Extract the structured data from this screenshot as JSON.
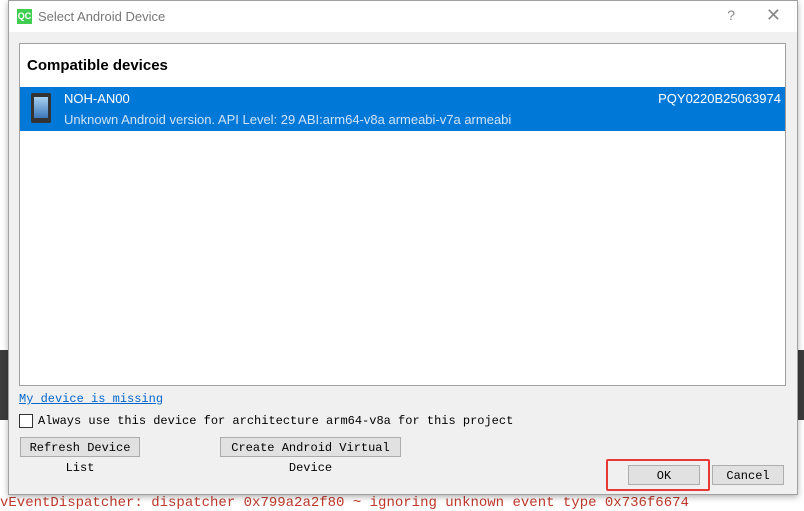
{
  "window": {
    "title": "Select Android Device",
    "help": "?",
    "close": "✕",
    "logo": "QC"
  },
  "list": {
    "header": "Compatible devices",
    "devices": [
      {
        "name": "NOH-AN00",
        "serial": "PQY0220B25063974",
        "description": "Unknown Android version. API Level: 29  ABI:arm64-v8a armeabi-v7a armeabi",
        "selected": true
      }
    ]
  },
  "missing_link": "My device is missing",
  "always_use": {
    "label": "Always use this device for architecture arm64-v8a for this project",
    "checked": false
  },
  "buttons": {
    "refresh": "Refresh Device List",
    "create_avd": "Create Android Virtual Device",
    "ok": "OK",
    "cancel": "Cancel"
  },
  "background_log": "vEventDispatcher: dispatcher 0x799a2a2f80 ~ ignoring unknown event type 0x736f6674",
  "colors": {
    "selection": "#0078d7",
    "highlight": "#e53935"
  }
}
